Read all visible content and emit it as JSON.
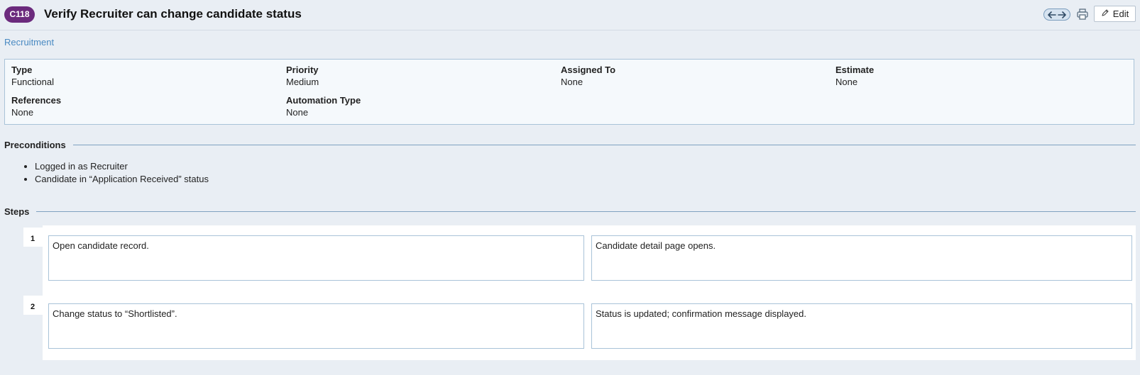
{
  "header": {
    "case_id": "C118",
    "title": "Verify Recruiter can change candidate status",
    "edit_label": "Edit",
    "icons": [
      "arrow-left-icon",
      "arrow-right-icon",
      "print-icon",
      "pencil-icon"
    ]
  },
  "breadcrumb": "Recruitment",
  "fields": {
    "type": {
      "label": "Type",
      "value": "Functional"
    },
    "priority": {
      "label": "Priority",
      "value": "Medium"
    },
    "assigned_to": {
      "label": "Assigned To",
      "value": "None"
    },
    "estimate": {
      "label": "Estimate",
      "value": "None"
    },
    "references": {
      "label": "References",
      "value": "None"
    },
    "automation_type": {
      "label": "Automation Type",
      "value": "None"
    }
  },
  "preconditions": {
    "heading": "Preconditions",
    "items": [
      "Logged in as Recruiter",
      "Candidate in “Application Received” status"
    ]
  },
  "steps": {
    "heading": "Steps",
    "items": [
      {
        "number": "1",
        "action": "Open candidate record.",
        "expected": "Candidate detail page opens."
      },
      {
        "number": "2",
        "action": "Change status to “Shortlisted”.",
        "expected": "Status is updated; confirmation message displayed."
      }
    ]
  },
  "colors": {
    "case_badge": "#6b2a7d",
    "link": "#4a8ac2",
    "background": "#e9eef4",
    "border": "#a9c3d8"
  }
}
